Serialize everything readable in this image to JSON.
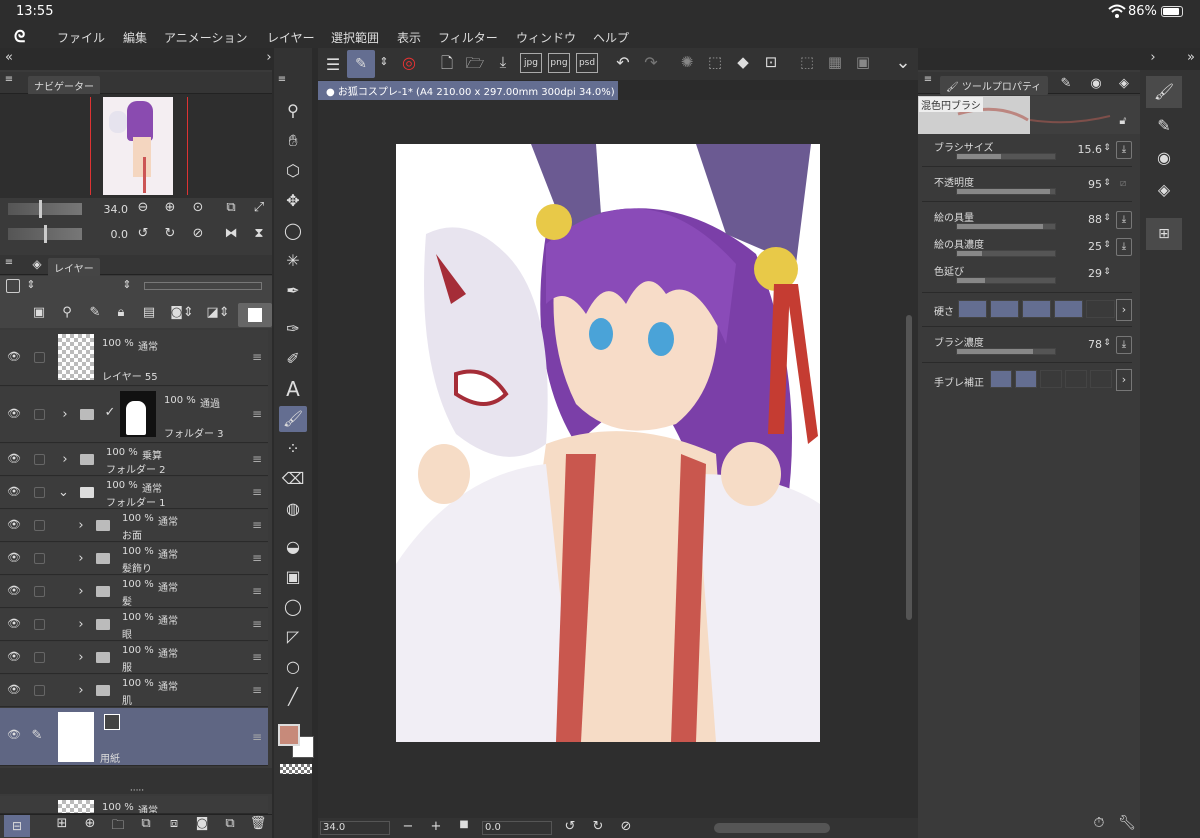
{
  "status": {
    "time": "13:55",
    "battery": "86%"
  },
  "menu": [
    "ファイル",
    "編集",
    "アニメーション",
    "レイヤー",
    "選択範囲",
    "表示",
    "フィルター",
    "ウィンドウ",
    "ヘルプ"
  ],
  "navigator": {
    "tab": "ナビゲーター",
    "zoom": "34.0",
    "rotate": "0.0"
  },
  "layers_panel": {
    "tab": "レイヤー"
  },
  "layers": [
    {
      "opacity": "100 %",
      "blend": "通常",
      "name": "レイヤー 55"
    },
    {
      "opacity": "100 %",
      "blend": "通過",
      "name": "フォルダー 3"
    },
    {
      "opacity": "100 %",
      "blend": "乗算",
      "name": "フォルダー 2"
    },
    {
      "opacity": "100 %",
      "blend": "通常",
      "name": "フォルダー 1"
    },
    {
      "opacity": "100 %",
      "blend": "通常",
      "name": "お面"
    },
    {
      "opacity": "100 %",
      "blend": "通常",
      "name": "髪飾り"
    },
    {
      "opacity": "100 %",
      "blend": "通常",
      "name": "髪"
    },
    {
      "opacity": "100 %",
      "blend": "通常",
      "name": "眼"
    },
    {
      "opacity": "100 %",
      "blend": "通常",
      "name": "服"
    },
    {
      "opacity": "100 %",
      "blend": "通常",
      "name": "肌"
    },
    {
      "opacity": "",
      "blend": "",
      "name": "用紙"
    },
    {
      "opacity": "100 %",
      "blend": "通常",
      "name": ""
    }
  ],
  "document": {
    "title": "お狐コスプレ-1* (A4 210.00 x 297.00mm 300dpi 34.0%)"
  },
  "bottom": {
    "zoom": "34.0",
    "rotate": "0.0"
  },
  "tool_property": {
    "tab": "ツールプロパティ",
    "brush": "混色円ブラシ",
    "size": {
      "label": "ブラシサイズ",
      "value": "15.6",
      "fill": 0.45
    },
    "opacity": {
      "label": "不透明度",
      "value": "95",
      "fill": 0.95
    },
    "paint_amount": {
      "label": "絵の具量",
      "value": "88",
      "fill": 0.88
    },
    "paint_density": {
      "label": "絵の具濃度",
      "value": "25",
      "fill": 0.25
    },
    "color_stretch": {
      "label": "色延び",
      "value": "29",
      "fill": 0.29
    },
    "hardness": {
      "label": "硬さ",
      "level": 4,
      "of": 5
    },
    "brush_density": {
      "label": "ブラシ濃度",
      "value": "78",
      "fill": 0.78
    },
    "stabilization": {
      "label": "手ブレ補正",
      "level": 2,
      "of": 5
    }
  },
  "colors": {
    "main": "#c78a7a",
    "sub": "#ffffff",
    "accent": "#646e91",
    "canvas_bg": "#2e2e2e"
  }
}
